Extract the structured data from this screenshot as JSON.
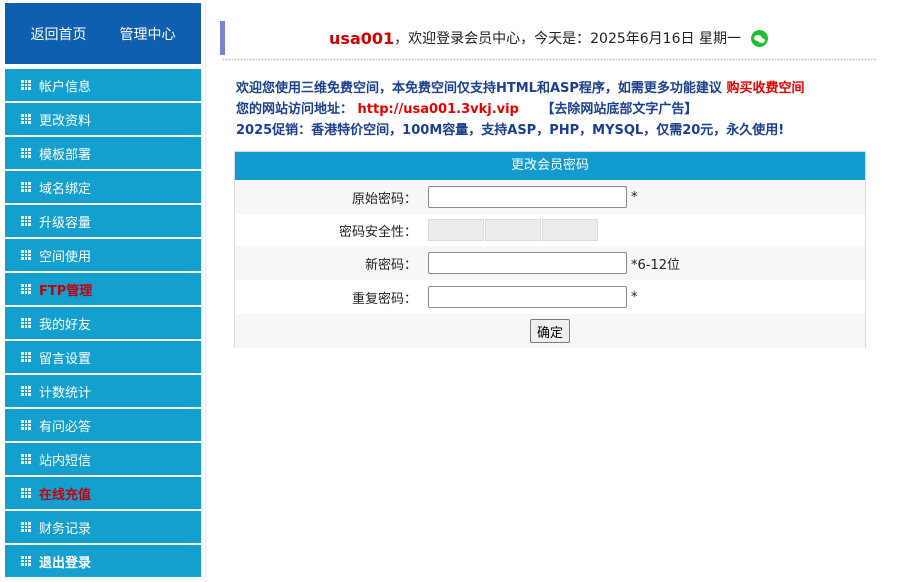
{
  "top_nav": {
    "home": "返回首页",
    "admin": "管理中心"
  },
  "sidebar": {
    "items": [
      {
        "label": "帐户信息",
        "style": "normal"
      },
      {
        "label": "更改资料",
        "style": "normal"
      },
      {
        "label": "模板部署",
        "style": "normal"
      },
      {
        "label": "域名绑定",
        "style": "normal"
      },
      {
        "label": "升级容量",
        "style": "normal"
      },
      {
        "label": "空间使用",
        "style": "normal"
      },
      {
        "label": "FTP管理",
        "style": "highlight"
      },
      {
        "label": "我的好友",
        "style": "normal"
      },
      {
        "label": "留言设置",
        "style": "normal"
      },
      {
        "label": "计数统计",
        "style": "normal"
      },
      {
        "label": "有问必答",
        "style": "normal"
      },
      {
        "label": "站内短信",
        "style": "normal"
      },
      {
        "label": "在线充值",
        "style": "highlight"
      },
      {
        "label": "财务记录",
        "style": "normal"
      },
      {
        "label": "退出登录",
        "style": "bold"
      }
    ]
  },
  "header": {
    "username": "usa001",
    "welcome": "，欢迎登录会员中心，今天是：",
    "date": "2025年6月16日 星期一",
    "icon": "wechat-icon"
  },
  "notice": {
    "line1_text": "欢迎您使用三维免费空间，本免费空间仅支持HTML和ASP程序，如需更多功能建议",
    "line1_link": "购买收费空间",
    "line2_label": "您的网站访问地址：",
    "line2_url": "http://usa001.3vkj.vip",
    "line2_remove": "【去除网站底部文字广告】",
    "line3": "2025促销：香港特价空间，100M容量，支持ASP，PHP，MYSQL，仅需20元，永久使用!"
  },
  "form": {
    "title": "更改会员密码",
    "old_label": "原始密码：",
    "old_value": "",
    "old_hint": "*",
    "strength_label": "密码安全性：",
    "strength_level": 0,
    "new_label": "新密码：",
    "new_value": "",
    "new_hint": "*6-12位",
    "repeat_label": "重复密码：",
    "repeat_value": "",
    "repeat_hint": "*",
    "submit": "确定"
  },
  "colors": {
    "nav_bg": "#0f5fb0",
    "menu_bg": "#14a0cf",
    "highlight": "#c3000a",
    "form_header": "#129bd0",
    "accent_bar": "#7b83cf"
  }
}
